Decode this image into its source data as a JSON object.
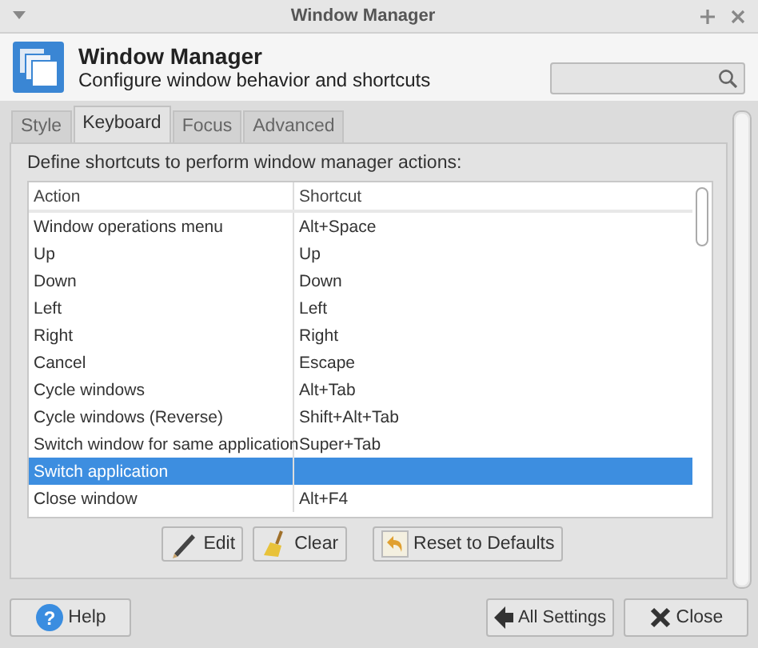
{
  "window": {
    "title": "Window Manager"
  },
  "header": {
    "title": "Window Manager",
    "subtitle": "Configure window behavior and shortcuts"
  },
  "tabs": [
    {
      "label": "Style",
      "selected": false
    },
    {
      "label": "Keyboard",
      "selected": true
    },
    {
      "label": "Focus",
      "selected": false
    },
    {
      "label": "Advanced",
      "selected": false
    }
  ],
  "instructions": "Define shortcuts to perform window manager actions:",
  "table": {
    "columns": [
      "Action",
      "Shortcut"
    ],
    "rows": [
      {
        "action": "Window operations menu",
        "shortcut": "Alt+Space",
        "selected": false
      },
      {
        "action": "Up",
        "shortcut": "Up",
        "selected": false
      },
      {
        "action": "Down",
        "shortcut": "Down",
        "selected": false
      },
      {
        "action": "Left",
        "shortcut": "Left",
        "selected": false
      },
      {
        "action": "Right",
        "shortcut": "Right",
        "selected": false
      },
      {
        "action": "Cancel",
        "shortcut": "Escape",
        "selected": false
      },
      {
        "action": "Cycle windows",
        "shortcut": "Alt+Tab",
        "selected": false
      },
      {
        "action": "Cycle windows (Reverse)",
        "shortcut": "Shift+Alt+Tab",
        "selected": false
      },
      {
        "action": "Switch window for same application",
        "shortcut": "Super+Tab",
        "selected": false
      },
      {
        "action": "Switch application",
        "shortcut": "",
        "selected": true
      },
      {
        "action": "Close window",
        "shortcut": "Alt+F4",
        "selected": false
      }
    ]
  },
  "table_buttons": [
    {
      "kind": "edit",
      "label": "Edit"
    },
    {
      "kind": "clear",
      "label": "Clear"
    },
    {
      "kind": "reset",
      "label": "Reset to Defaults"
    }
  ],
  "footer_buttons": [
    {
      "kind": "help",
      "label": "Help",
      "icon_text": "?"
    },
    {
      "kind": "settings",
      "label": "All Settings"
    },
    {
      "kind": "close",
      "label": "Close"
    }
  ]
}
